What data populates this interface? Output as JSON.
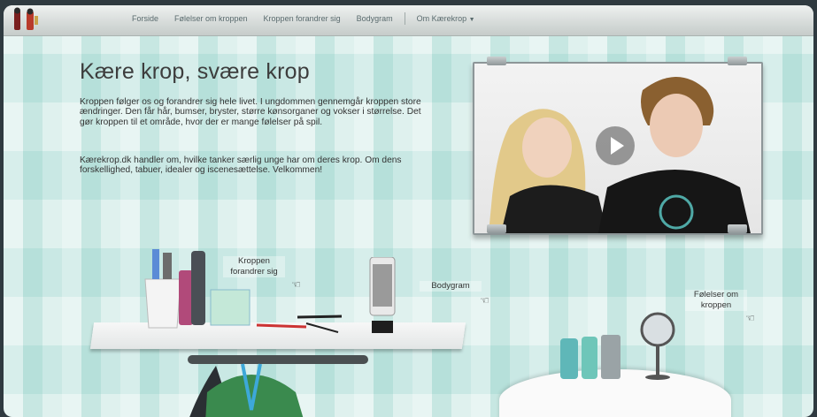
{
  "nav": {
    "items": [
      "Forside",
      "Følelser om kroppen",
      "Kroppen forandrer sig",
      "Bodygram"
    ],
    "dropdown": "Om Kærekrop"
  },
  "hero": {
    "title": "Kære krop, svære krop",
    "paragraph1": "Kroppen følger os og forandrer sig hele livet. I ungdommen gennemgår kroppen store ændringer. Den får hår, bumser, bryster, større kønsorganer og vokser i størrelse. Det gør kroppen til et område, hvor der er mange følelser på spil.",
    "paragraph2": "Kærekrop.dk handler om, hvilke tanker særlig unge har om deres krop. Om dens forskellighed, tabuer, idealer og iscenesættelse. Velkommen!"
  },
  "bubbles": {
    "kroppen": "Kroppen forandrer sig",
    "bodygram": "Bodygram",
    "folelser": "Følelser om kroppen"
  },
  "colors": {
    "frame_bg": "#cfeae6",
    "topbar": "#d5dad8",
    "text": "#333333"
  }
}
